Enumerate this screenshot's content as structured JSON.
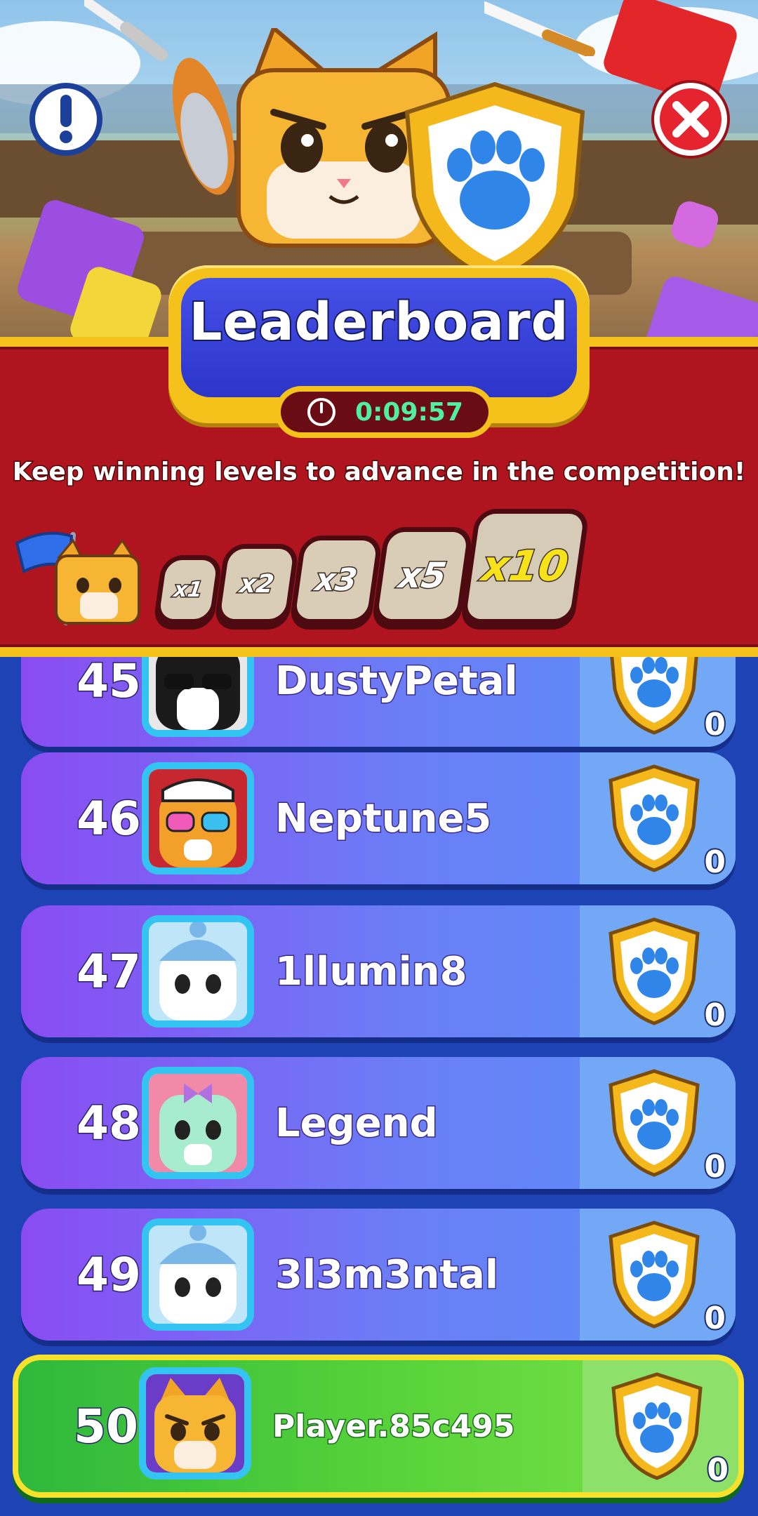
{
  "header": {
    "title": "Leaderboard",
    "timer": "0:09:57",
    "subtitle": "Keep winning levels to advance in the competition!"
  },
  "buttons": {
    "info_icon": "exclamation-icon",
    "close_icon": "close-icon"
  },
  "multipliers": [
    "x1",
    "x2",
    "x3",
    "x5",
    "x10"
  ],
  "leaderboard": [
    {
      "rank": "45",
      "name": "DustyPetal",
      "score": "0",
      "avatar": "tuxedo-cat-sunglasses"
    },
    {
      "rank": "46",
      "name": "Neptune5",
      "score": "0",
      "avatar": "tiger-cat-cap-sunglasses"
    },
    {
      "rank": "47",
      "name": "1llumin8",
      "score": "0",
      "avatar": "white-cat-beanie"
    },
    {
      "rank": "48",
      "name": "Legend",
      "score": "0",
      "avatar": "mint-cat-bow"
    },
    {
      "rank": "49",
      "name": "3l3m3ntal",
      "score": "0",
      "avatar": "white-cat-beanie"
    },
    {
      "rank": "50",
      "name": "Player.85c495",
      "score": "0",
      "avatar": "orange-cat-player",
      "is_current_player": true
    }
  ],
  "colors": {
    "banner_red": "#b0141e",
    "gold": "#f4c21a",
    "title_blue": "#3a44d8",
    "row_purple": "#8a4cf2",
    "row_blue": "#5a8ef8",
    "player_green": "#4cc83a",
    "timer_green": "#4ff0a0",
    "x10_yellow": "#f8e21a"
  }
}
